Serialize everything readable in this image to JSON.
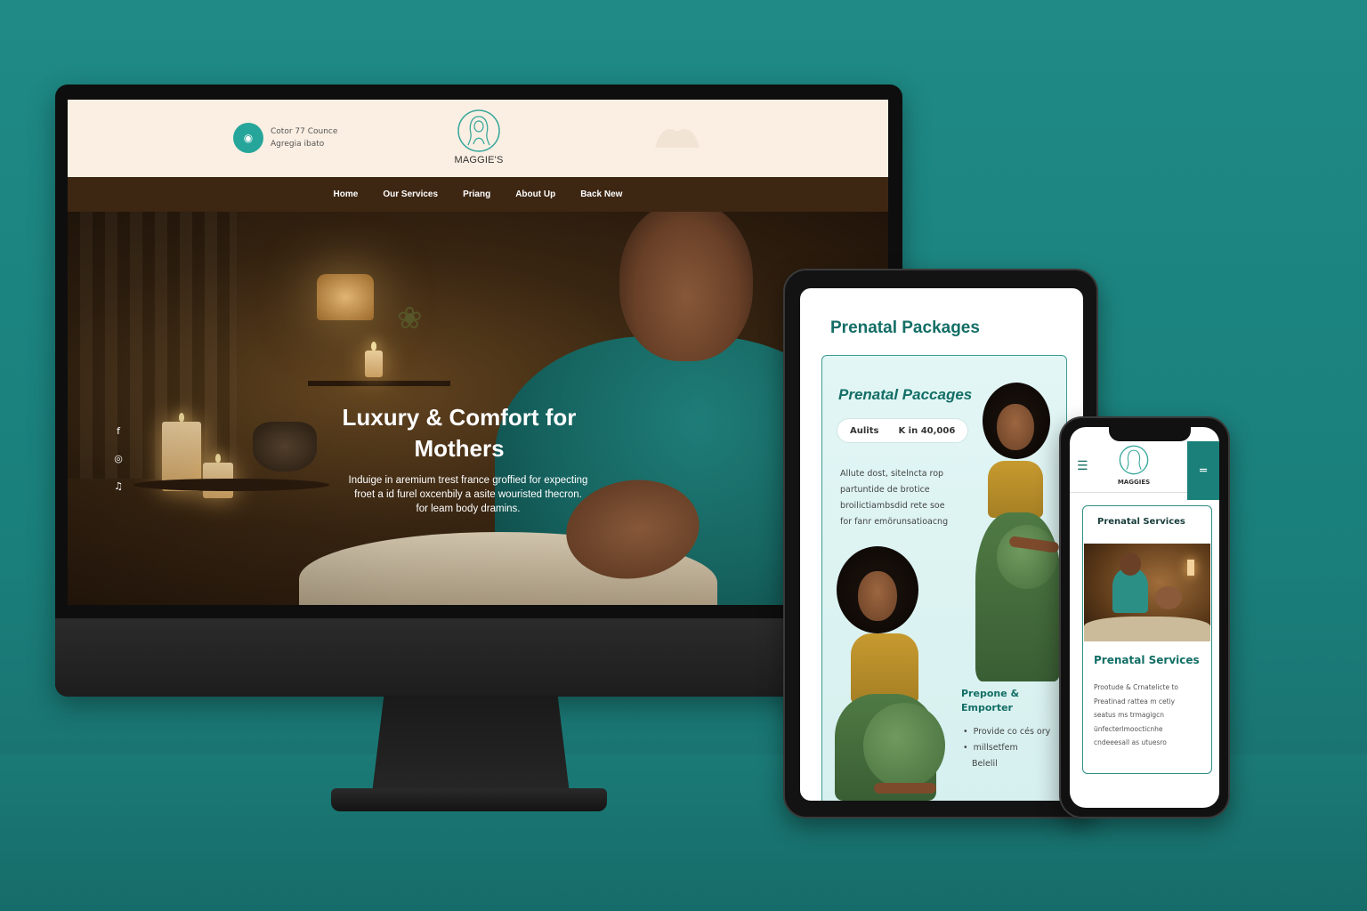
{
  "desktop": {
    "header": {
      "contact_line1": "Cotor 77 Counce",
      "contact_line2": "Agregia ibato",
      "logo_text": "MAGGIE'S"
    },
    "nav": [
      "Home",
      "Our Services",
      "Priang",
      "About Up",
      "Back New"
    ],
    "hero": {
      "title": "Luxury & Comfort for Mothers",
      "subtitle_line1": "Induige in aremium trest france groffied for expecting",
      "subtitle_line2": "froet a id furel oxcenbily a asite wouristed thecron.",
      "subtitle_line3": "for leam body dramins."
    },
    "socials": [
      "facebook-icon",
      "instagram-icon",
      "tiktok-icon"
    ]
  },
  "tablet": {
    "page_title": "Prenatal Packages",
    "card": {
      "title": "Prenatal Paccages",
      "pill_label": "Aulits",
      "pill_price": "K in 40,006",
      "desc_lines": [
        "Allute dost, sitelncta rop",
        "partuntide de brotice",
        "broilictiambsdid rete soe",
        "for fanr emörunsatioacng"
      ],
      "emp_title_line1": "Prepone &",
      "emp_title_line2": "Emporter",
      "list": [
        "Provide co cés ory",
        "millsetfem",
        "Belelil"
      ]
    }
  },
  "phone": {
    "logo_text": "MAGGIES",
    "card": {
      "title": "Prenatal Services",
      "subtitle": "Prenatal Services",
      "desc_lines": [
        "Prootude & Crnatelicte to",
        "Preatinad rattea m cetiy",
        "seatus ms trmagigcn",
        "ünfecterlmoocticnhe",
        "cndeeesall as utuesro"
      ]
    }
  },
  "colors": {
    "background": "#1f8a86",
    "teal_accent": "#136e66",
    "header_cream": "#fbefe3",
    "nav_brown": "#3d2612"
  }
}
